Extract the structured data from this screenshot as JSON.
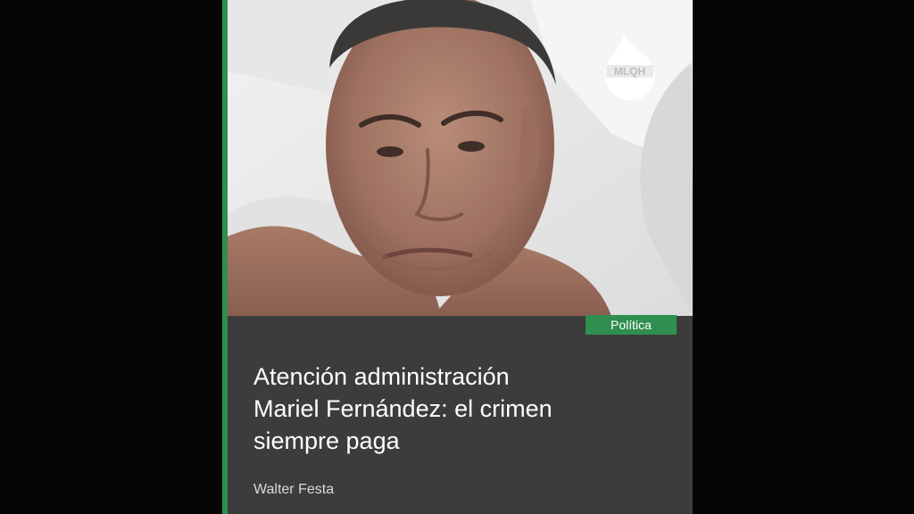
{
  "article": {
    "category": "Política",
    "headline_lines": [
      "Atención administración",
      "Mariel Fernández: el crimen",
      "siempre paga"
    ],
    "author": "Walter Festa"
  },
  "logo": {
    "text": "MLQH"
  },
  "colors": {
    "background": "#050506",
    "card": "#3c3c3c",
    "accent": "#2f8f4e",
    "text": "#ffffff"
  }
}
